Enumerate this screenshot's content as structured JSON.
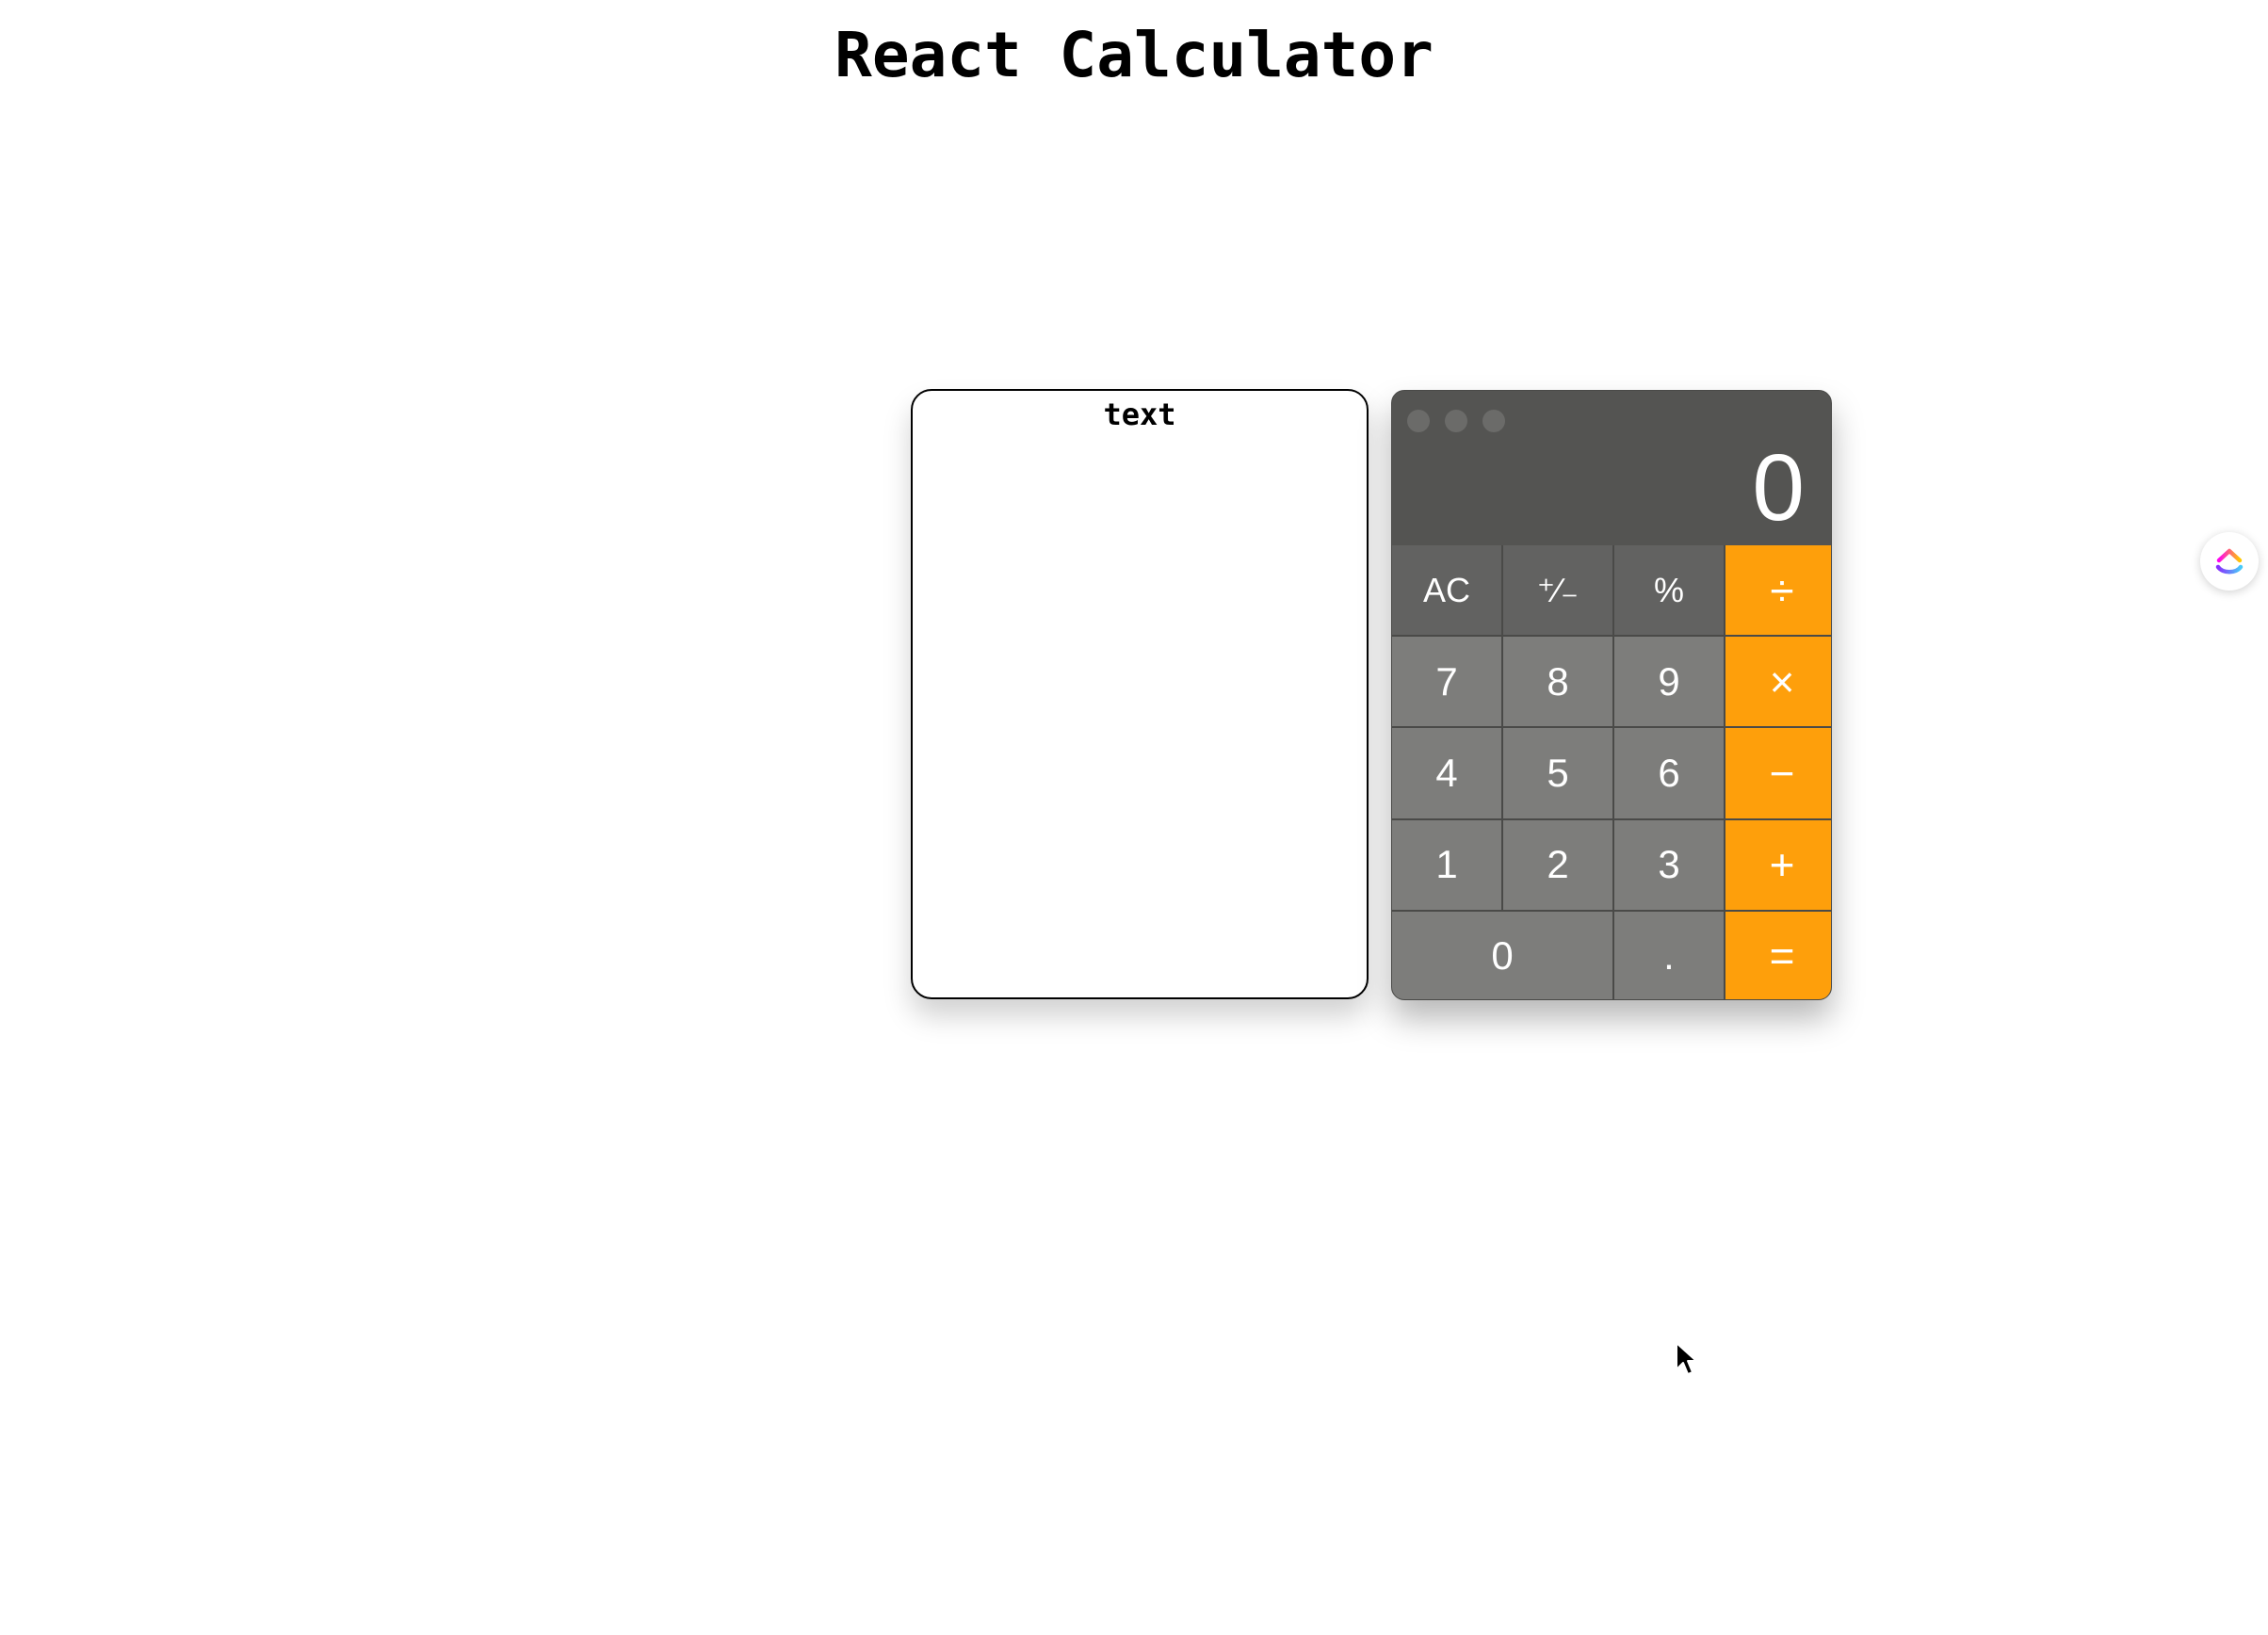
{
  "page": {
    "title": "React Calculator"
  },
  "text_panel": {
    "label": "text"
  },
  "calculator": {
    "display_value": "0",
    "keys": {
      "ac": "AC",
      "sign": "⁺∕₋",
      "percent": "%",
      "divide": "÷",
      "seven": "7",
      "eight": "8",
      "nine": "9",
      "multiply": "×",
      "four": "4",
      "five": "5",
      "six": "6",
      "minus": "−",
      "one": "1",
      "two": "2",
      "three": "3",
      "plus": "+",
      "zero": "0",
      "decimal": ".",
      "equals": "="
    },
    "colors": {
      "operator": "#fe9f0b",
      "function_key": "#626261",
      "number_key": "#7d7d7b",
      "display_bg": "#545452"
    }
  },
  "icons": {
    "window_controls": [
      "close-icon",
      "minimize-icon",
      "zoom-icon"
    ],
    "floating_badge": "clickup-logo-icon",
    "pointer": "mouse-cursor-icon"
  }
}
